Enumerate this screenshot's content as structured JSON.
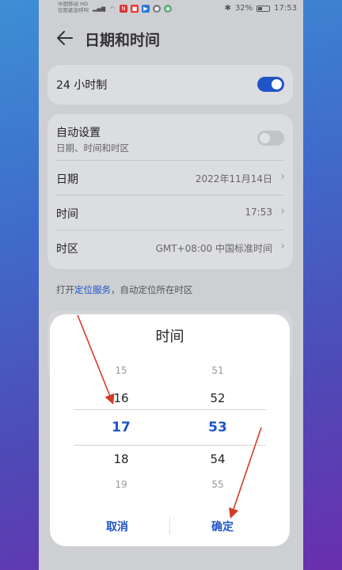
{
  "status_bar": {
    "carrier_line1": "中国移动 HD",
    "carrier_line2": "仅限紧急呼叫",
    "battery_percent": "32%",
    "time": "17:53"
  },
  "header": {
    "title": "日期和时间"
  },
  "settings": {
    "hour24": {
      "label": "24 小时制",
      "enabled": true
    },
    "auto": {
      "label": "自动设置",
      "sublabel": "日期、时间和时区",
      "enabled": false
    },
    "date": {
      "label": "日期",
      "value": "2022年11月14日"
    },
    "time": {
      "label": "时间",
      "value": "17:53"
    },
    "timezone": {
      "label": "时区",
      "value": "GMT+08:00 中国标准时间"
    }
  },
  "hint": {
    "prefix": "打开",
    "link": "定位服务",
    "suffix": "，自动定位所在时区"
  },
  "dialog": {
    "title": "时间",
    "hours": [
      "15",
      "16",
      "17",
      "18",
      "19"
    ],
    "minutes": [
      "51",
      "52",
      "53",
      "54",
      "55"
    ],
    "cancel_label": "取消",
    "confirm_label": "确定"
  },
  "colors": {
    "accent": "#1f55c8",
    "annotation": "#d23a2a"
  }
}
